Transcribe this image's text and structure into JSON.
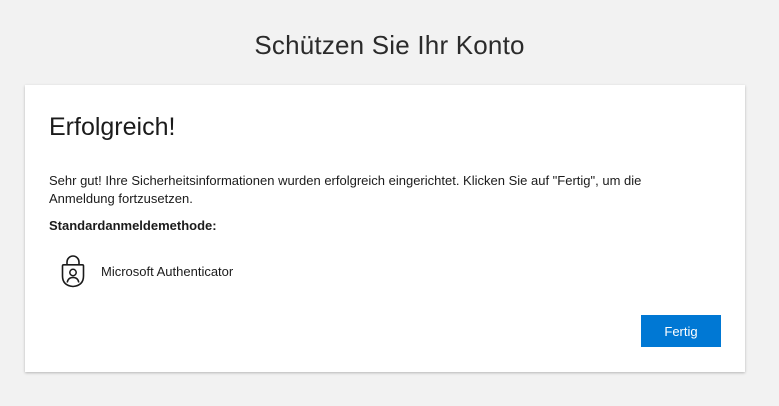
{
  "page": {
    "title": "Schützen Sie Ihr Konto"
  },
  "card": {
    "heading": "Erfolgreich!",
    "message": "Sehr gut! Ihre Sicherheitsinformationen wurden erfolgreich eingerichtet. Klicken Sie auf \"Fertig\", um die Anmeldung fortzusetzen.",
    "default_method_label": "Standardanmeldemethode:",
    "method": {
      "icon": "authenticator-lock-icon",
      "name": "Microsoft Authenticator"
    },
    "done_button_label": "Fertig"
  },
  "colors": {
    "background": "#f2f2f2",
    "card": "#ffffff",
    "accent": "#0078d4",
    "text": "#1b1b1b"
  }
}
